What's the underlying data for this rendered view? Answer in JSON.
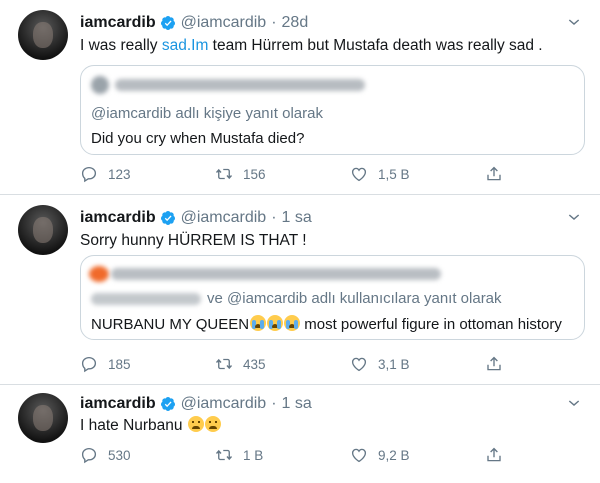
{
  "tweets": [
    {
      "name": "iamcardib",
      "handle": "@iamcardib",
      "separator": "·",
      "time": "28d",
      "text_pre": "I was really ",
      "text_link": "sad.Im",
      "text_post": " team Hürrem but Mustafa death was really sad .",
      "quote": {
        "reply_context": "@iamcardib adlı kişiye yanıt olarak",
        "text": "Did you cry when Mustafa died?"
      },
      "replies": "123",
      "retweets": "156",
      "likes": "1,5 B"
    },
    {
      "name": "iamcardib",
      "handle": "@iamcardib",
      "separator": "·",
      "time": "1 sa",
      "text": "Sorry hunny HÜRREM IS THAT !",
      "quote": {
        "reply_context": "ve @iamcardib adlı kullanıcılara yanıt olarak",
        "text_pre": "NURBANU MY QUEEN",
        "text_post": " most powerful figure in ottoman history"
      },
      "replies": "185",
      "retweets": "435",
      "likes": "3,1 B"
    },
    {
      "name": "iamcardib",
      "handle": "@iamcardib",
      "separator": "·",
      "time": "1 sa",
      "text": "I hate Nurbanu",
      "replies": "530",
      "retweets": "1 B",
      "likes": "9,2 B"
    }
  ],
  "icons": [
    "verified-badge-icon",
    "chevron-down-icon",
    "reply-icon",
    "retweet-icon",
    "like-icon",
    "share-icon",
    "crying-face-emoji",
    "disappointed-face-emoji"
  ],
  "colors": {
    "link": "#1b95e0",
    "verified": "#1da1f2",
    "muted": "#657786",
    "border": "#ccd6dd"
  }
}
